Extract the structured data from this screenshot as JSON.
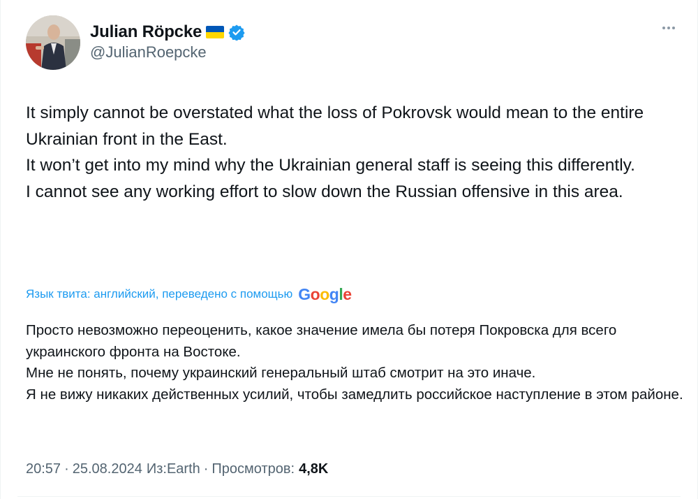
{
  "author": {
    "display_name": "Julian Röpcke",
    "handle": "@JulianRoepcke",
    "flag_icon": "ukraine-flag-icon",
    "verified_icon": "verified-badge-icon",
    "verified_color": "#1d9bf0"
  },
  "more_icon": "more-horizontal-icon",
  "tweet": {
    "paragraphs": [
      "It simply cannot be overstated what the loss of Pokrovsk would mean to the entire Ukrainian front in the East.",
      "It won’t get into my mind why the Ukrainian general staff is seeing this differently.",
      "I cannot see any working effort to slow down the Russian offensive in this area."
    ]
  },
  "translation": {
    "label": "Язык твита: английский, переведено с помощью",
    "provider_letters": [
      "G",
      "o",
      "o",
      "g",
      "l",
      "e"
    ],
    "provider_colors": [
      "#4285f4",
      "#ea4335",
      "#fbbc05",
      "#4285f4",
      "#34a853",
      "#ea4335"
    ],
    "paragraphs": [
      "Просто невозможно переоценить, какое значение имела бы потеря Покровска для всего украинского фронта на Востоке.",
      "Мне не понять, почему украинский генеральный штаб смотрит на это иначе.",
      "Я не вижу никаких действенных усилий, чтобы замедлить российское наступление в этом районе."
    ]
  },
  "meta": {
    "time": "20:57",
    "date": "25.08.2024",
    "source": "Из:Earth",
    "views_label": "Просмотров:",
    "views_count": "4,8K",
    "separator": "·"
  },
  "colors": {
    "accent": "#1d9bf0",
    "secondary_text": "#536471",
    "primary_text": "#0f1419"
  }
}
